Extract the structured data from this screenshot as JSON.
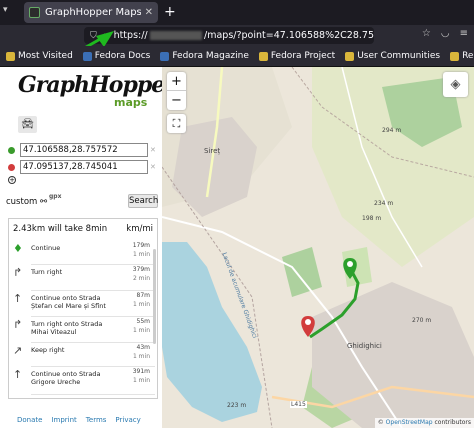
{
  "browser": {
    "tab_title": "GraphHopper Maps - Dri",
    "new_tab": "+",
    "url_prefix": "https://",
    "url_suffix": "/maps/?point=47.106588%2C28.75",
    "bookmarks": [
      "Most Visited",
      "Fedora Docs",
      "Fedora Magazine",
      "Fedora Project",
      "User Communities",
      "Red Hat"
    ]
  },
  "sidebar": {
    "logo_text": "GraphHopper",
    "logo_sub": "maps",
    "points": [
      {
        "value": "47.106588,28.757572",
        "color": "#3a9b2c"
      },
      {
        "value": "47.095137,28.745041",
        "color": "#d23c3c"
      }
    ],
    "custom_label": "custom",
    "gpx_label": "gpx",
    "search_label": "Search",
    "summary": "2.43km will take 8min",
    "unit_label": "km/mi",
    "instructions": [
      {
        "icon": "marker-icon",
        "glyph": "♦",
        "text": "Continue",
        "dist": "179m",
        "time": "1 min"
      },
      {
        "icon": "turn-right-icon",
        "glyph": "↱",
        "text": "Turn right",
        "dist": "379m",
        "time": "2 min"
      },
      {
        "icon": "continue-icon",
        "glyph": "↑",
        "text": "Continue onto Strada Ștefan cel Mare și Sfînt",
        "dist": "87m",
        "time": "1 min"
      },
      {
        "icon": "turn-right-icon",
        "glyph": "↱",
        "text": "Turn right onto Strada Mihai Viteazul",
        "dist": "55m",
        "time": "1 min"
      },
      {
        "icon": "keep-right-icon",
        "glyph": "↗",
        "text": "Keep right",
        "dist": "43m",
        "time": "1 min"
      },
      {
        "icon": "continue-icon",
        "glyph": "↑",
        "text": "Continue onto Strada Grigore Ureche",
        "dist": "391m",
        "time": "1 min"
      }
    ],
    "footer": [
      "Donate",
      "Imprint",
      "Terms",
      "Privacy"
    ]
  },
  "map": {
    "zoom_in": "+",
    "zoom_out": "−",
    "labels": [
      "Sireț",
      "Lacul de acumulare Ghidighici",
      "Ghidighici",
      "L415",
      "294 m",
      "234 m",
      "198 m",
      "270 m",
      "223 m"
    ],
    "attribution_prefix": "© ",
    "attribution_link": "OpenStreetMap",
    "attribution_suffix": " contributors"
  }
}
